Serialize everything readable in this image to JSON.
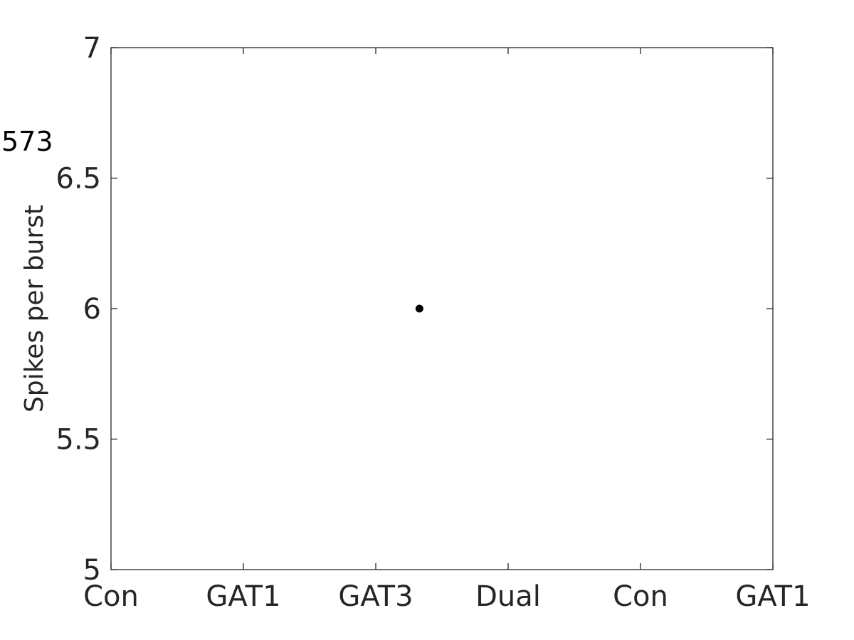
{
  "chart_data": {
    "type": "scatter",
    "title": "",
    "xlabel": "",
    "ylabel": "Spikes per burst",
    "annotation": "573",
    "xlim": [
      1,
      6
    ],
    "ylim": [
      5,
      7
    ],
    "x_ticks": [
      1,
      2,
      3,
      4,
      5,
      6
    ],
    "x_tick_labels": [
      "Con",
      "GAT1",
      "GAT3",
      "Dual",
      "Con",
      "GAT1"
    ],
    "y_ticks": [
      5,
      5.5,
      6,
      6.5,
      7
    ],
    "y_tick_labels": [
      "5",
      "5.5",
      "6",
      "6.5",
      "7"
    ],
    "grid": false,
    "legend": null,
    "series": [
      {
        "name": "data",
        "color": "#000000",
        "points": [
          {
            "x": 3.33,
            "y": 6
          }
        ]
      }
    ]
  }
}
